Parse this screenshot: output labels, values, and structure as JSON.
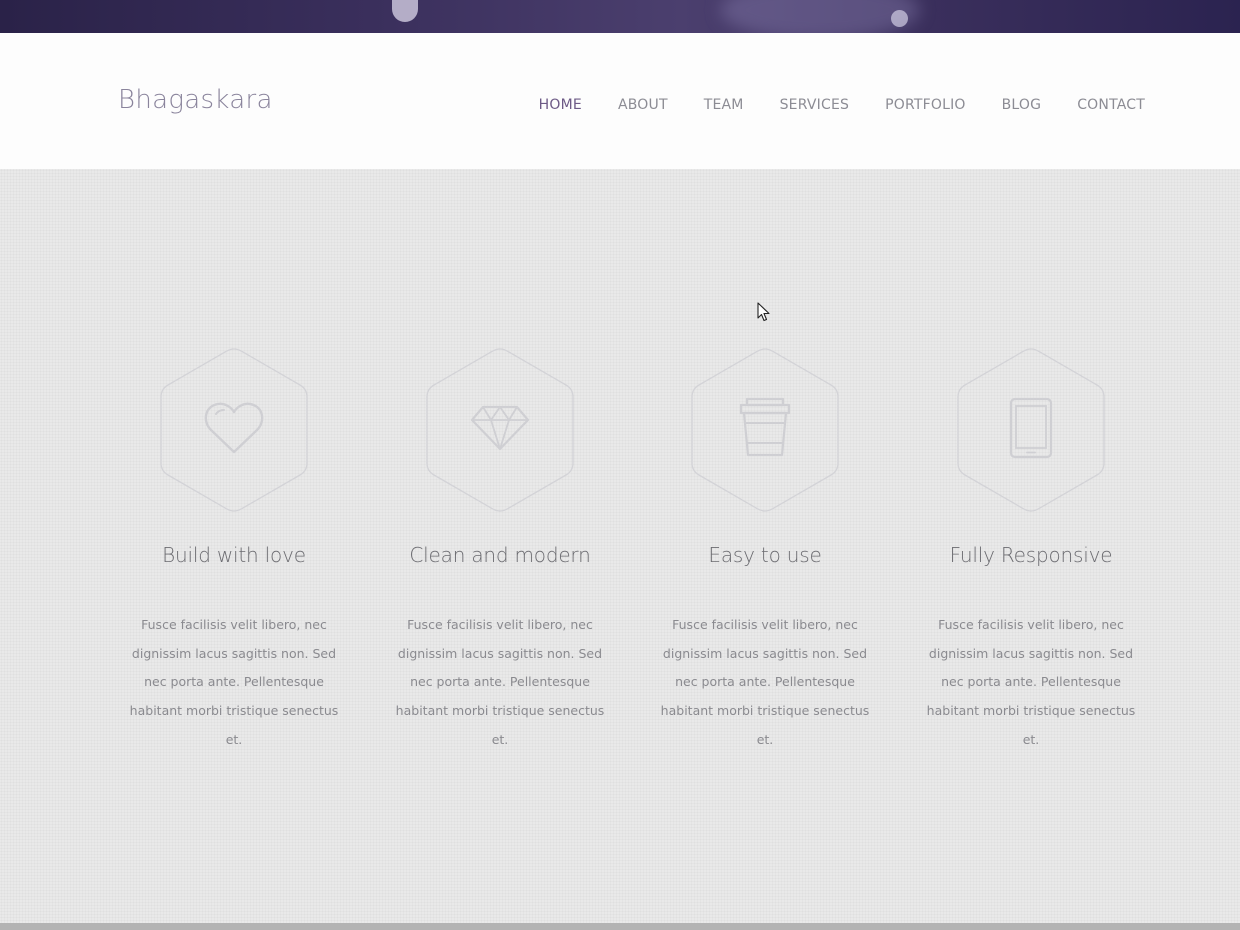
{
  "brand": {
    "logo_text": "Bhagaskara"
  },
  "nav": {
    "items": [
      {
        "label": "HOME",
        "active": true
      },
      {
        "label": "ABOUT",
        "active": false
      },
      {
        "label": "TEAM",
        "active": false
      },
      {
        "label": "SERVICES",
        "active": false
      },
      {
        "label": "PORTFOLIO",
        "active": false
      },
      {
        "label": "BLOG",
        "active": false
      },
      {
        "label": "CONTACT",
        "active": false
      }
    ]
  },
  "features": [
    {
      "icon": "heart-icon",
      "title": "Build with love",
      "description": "Fusce facilisis velit libero, nec dignissim lacus sagittis non. Sed nec porta ante. Pellentesque habitant morbi tristique senectus et."
    },
    {
      "icon": "diamond-icon",
      "title": "Clean and modern",
      "description": "Fusce facilisis velit libero, nec dignissim lacus sagittis non. Sed nec porta ante. Pellentesque habitant morbi tristique senectus et."
    },
    {
      "icon": "coffee-cup-icon",
      "title": "Easy to use",
      "description": "Fusce facilisis velit libero, nec dignissim lacus sagittis non. Sed nec porta ante. Pellentesque habitant morbi tristique senectus et."
    },
    {
      "icon": "tablet-icon",
      "title": "Fully Responsive",
      "description": "Fusce facilisis velit libero, nec dignissim lacus sagittis non. Sed nec porta ante. Pellentesque habitant morbi tristique senectus et."
    }
  ],
  "colors": {
    "accent": "#6d5a86",
    "nav_text": "#8c8c94",
    "icon_stroke": "#cfcfd3",
    "hero_dark": "#2a2248"
  }
}
